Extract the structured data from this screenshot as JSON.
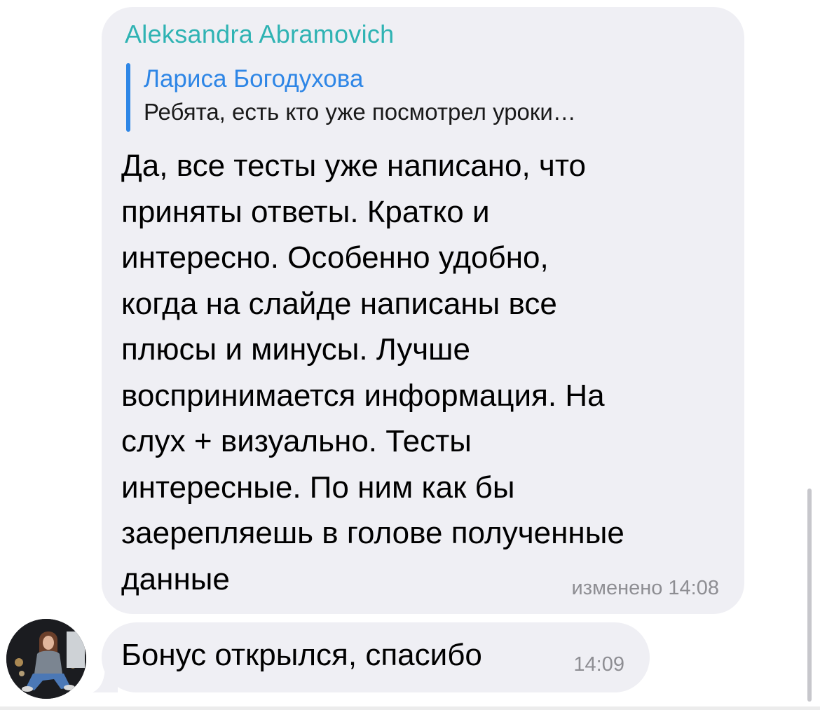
{
  "messages": [
    {
      "sender": "Aleksandra Abramovich",
      "reply": {
        "name": "Лариса Богодухова",
        "text": "Ребята, есть кто уже посмотрел уроки…"
      },
      "text": "Да, все  тесты уже написано, что\nприняты ответы. Кратко и\nинтересно. Особенно удобно,\nкогда на слайде написаны все\nплюсы и минусы. Лучше\nвоспринимается информация. На\nслух + визуально. Тесты\nинтересные. По ним как бы\nзаерепляешь в голове полученные\nданные",
      "meta": "изменено 14:08"
    },
    {
      "text": "Бонус открылся, спасибо",
      "meta": "14:09"
    }
  ],
  "colors": {
    "bubble_bg": "#efeff4",
    "sender_name": "#2fb3b3",
    "reply_accent": "#2e86e6",
    "meta_text": "#8e8e93"
  },
  "icons": {
    "avatar": "user-avatar-photo"
  }
}
